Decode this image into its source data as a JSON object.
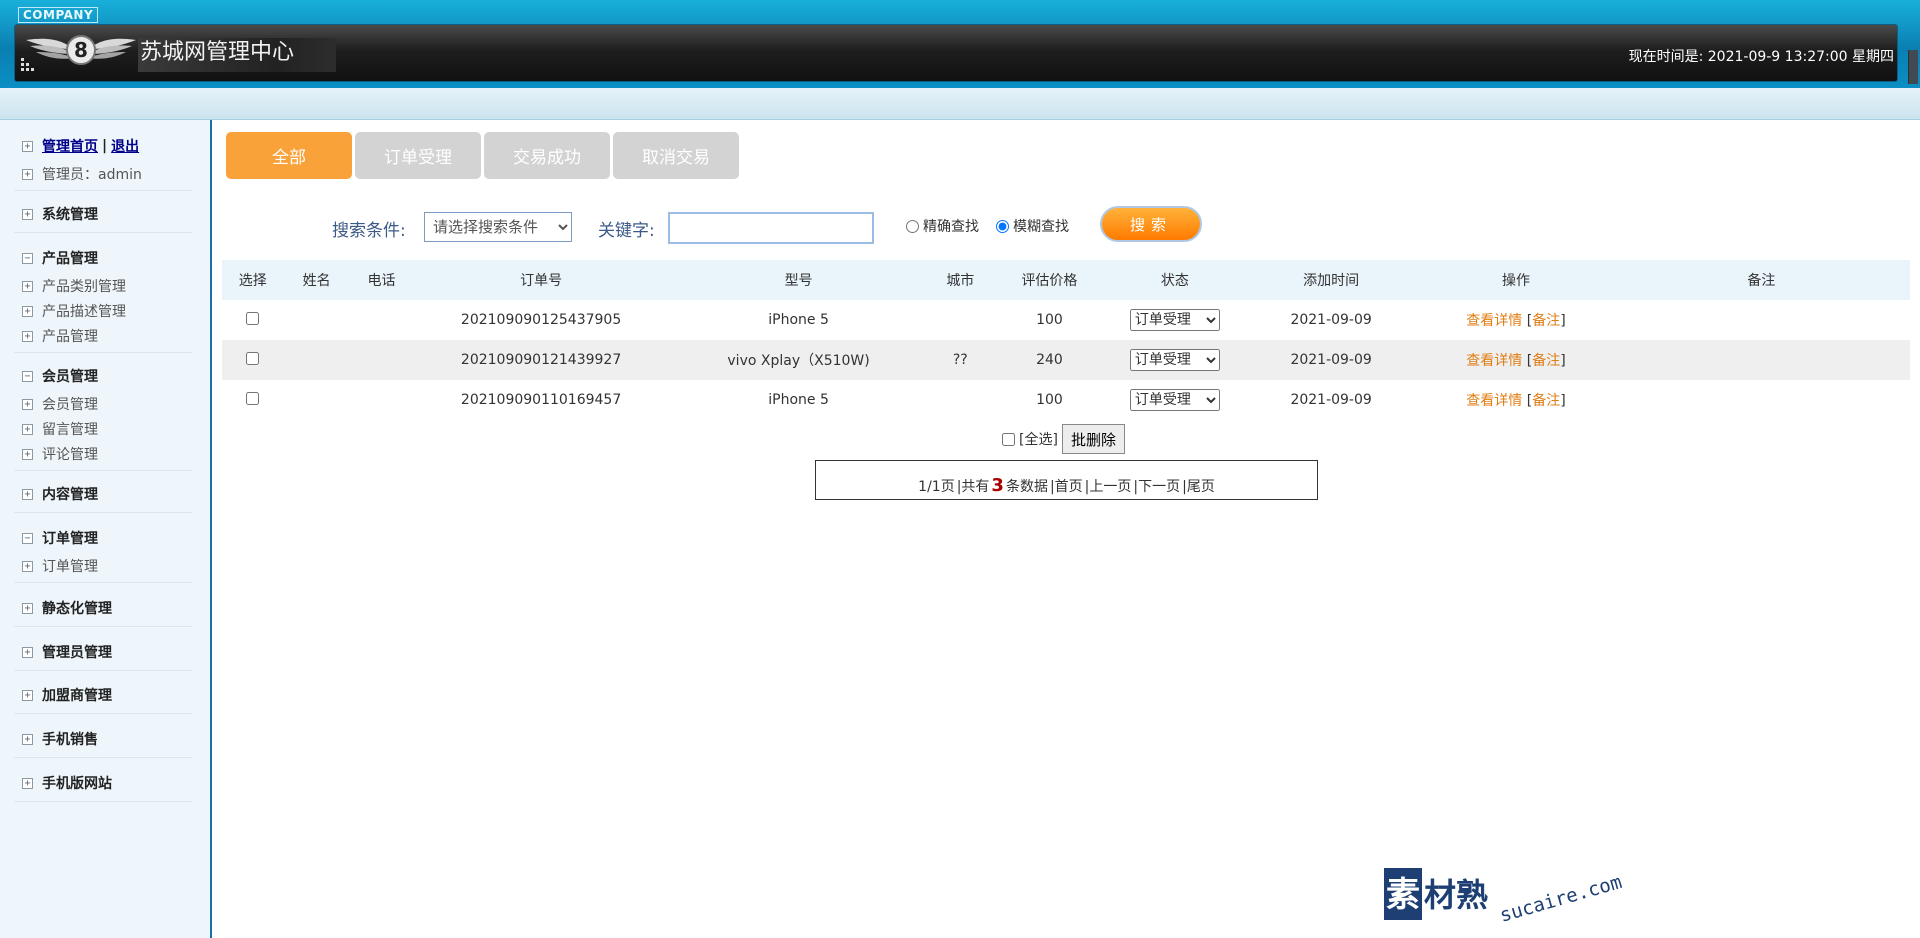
{
  "header": {
    "company": "COMPANY",
    "title": "苏城网管理中心",
    "clock": "现在时间是:  2021-09-9 13:27:00 星期四"
  },
  "sidebar": {
    "home": "管理首页",
    "divider": "|",
    "logout": "退出",
    "admin": "管理员：admin",
    "groups": [
      {
        "label": "系统管理",
        "items": []
      },
      {
        "label": "产品管理",
        "items": [
          "产品类别管理",
          "产品描述管理",
          "产品管理"
        ]
      },
      {
        "label": "会员管理",
        "items": [
          "会员管理",
          "留言管理",
          "评论管理"
        ]
      },
      {
        "label": "内容管理",
        "items": []
      },
      {
        "label": "订单管理",
        "items": [
          "订单管理"
        ]
      },
      {
        "label": "静态化管理",
        "items": []
      },
      {
        "label": "管理员管理",
        "items": []
      },
      {
        "label": "加盟商管理",
        "items": []
      },
      {
        "label": "手机销售",
        "items": []
      },
      {
        "label": "手机版网站",
        "items": []
      }
    ]
  },
  "tabs": [
    "全部",
    "订单受理",
    "交易成功",
    "取消交易"
  ],
  "search": {
    "condition_label": "搜索条件:",
    "condition_value": "请选择搜索条件",
    "keyword_label": "关键字:",
    "keyword_value": "",
    "exact": "精确查找",
    "fuzzy": "模糊查找",
    "button": "搜索"
  },
  "table": {
    "headers": [
      "选择",
      "姓名",
      "电话",
      "订单号",
      "型号",
      "城市",
      "评估价格",
      "状态",
      "添加时间",
      "操作",
      "备注"
    ],
    "rows": [
      {
        "name": "",
        "phone": "",
        "order": "202109090125437905",
        "model": "iPhone 5",
        "city": "",
        "price": "100",
        "status": "订单受理",
        "date": "2021-09-09",
        "remark": ""
      },
      {
        "name": "",
        "phone": "",
        "order": "202109090121439927",
        "model": "vivo Xplay（X510W)",
        "city": "??",
        "price": "240",
        "status": "订单受理",
        "date": "2021-09-09",
        "remark": ""
      },
      {
        "name": "",
        "phone": "",
        "order": "202109090110169457",
        "model": "iPhone 5",
        "city": "",
        "price": "100",
        "status": "订单受理",
        "date": "2021-09-09",
        "remark": ""
      }
    ],
    "op_view": "查看详情",
    "op_remark": "备注"
  },
  "batch": {
    "select_all": "[全选]",
    "delete": "批删除"
  },
  "pager": {
    "page": "1/1页",
    "total_prefix": "|共有",
    "total": "3",
    "total_suffix": "条数据",
    "first": "|首页",
    "prev": "|上一页",
    "next": "|下一页",
    "last": "|尾页"
  },
  "watermark": {
    "brand": "素材熟",
    "url": "sucaire.com"
  }
}
